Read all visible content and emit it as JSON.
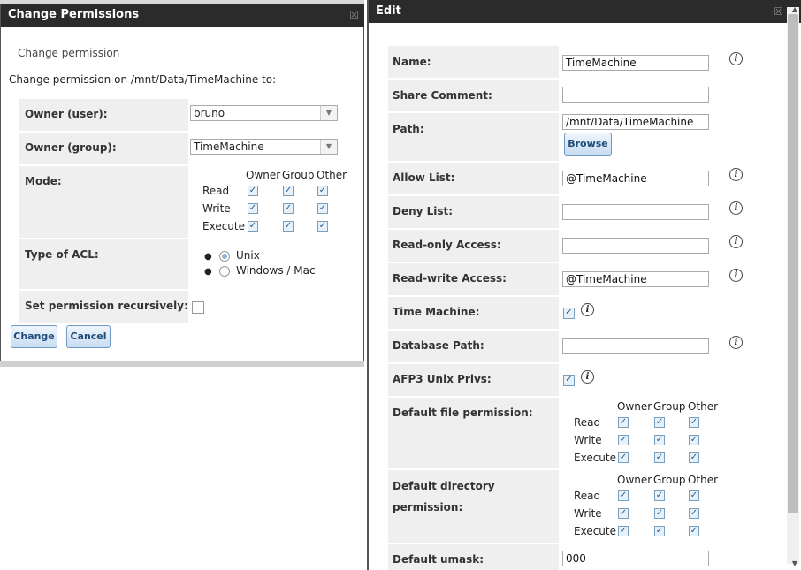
{
  "perm": {
    "title": "Change Permissions",
    "close": "☒",
    "subtitle": "Change permission",
    "description": "Change permission on /mnt/Data/TimeMachine to:",
    "owner_user_label": "Owner (user):",
    "owner_user_value": "bruno",
    "owner_group_label": "Owner (group):",
    "owner_group_value": "TimeMachine",
    "mode_label": "Mode:",
    "col_owner": "Owner",
    "col_group": "Group",
    "col_other": "Other",
    "row_read": "Read",
    "row_write": "Write",
    "row_execute": "Execute",
    "acl_label": "Type of ACL:",
    "acl_unix": "Unix",
    "acl_windows": "Windows / Mac",
    "recursive_label": "Set permission recursively:",
    "change_button": "Change",
    "cancel_button": "Cancel"
  },
  "edit": {
    "title": "Edit",
    "close": "☒",
    "name_label": "Name:",
    "name_value": "TimeMachine",
    "comment_label": "Share Comment:",
    "comment_value": "",
    "path_label": "Path:",
    "path_value": "/mnt/Data/TimeMachine",
    "browse_button": "Browse",
    "allow_label": "Allow List:",
    "allow_value": "@TimeMachine",
    "deny_label": "Deny List:",
    "deny_value": "",
    "ro_label": "Read-only Access:",
    "ro_value": "",
    "rw_label": "Read-write Access:",
    "rw_value": "@TimeMachine",
    "tm_label": "Time Machine:",
    "db_label": "Database Path:",
    "db_value": "",
    "afp3_label": "AFP3 Unix Privs:",
    "file_perm_label": "Default file permission:",
    "dir_perm_label_1": "Default directory",
    "dir_perm_label_2": "permission:",
    "col_owner": "Owner",
    "col_group": "Group",
    "col_other": "Other",
    "row_read": "Read",
    "row_write": "Write",
    "row_execute": "Execute",
    "umask_label": "Default umask:",
    "umask_value": "000",
    "info_glyph": "i"
  },
  "colors": {
    "titlebar": "#2b2b2b",
    "label_cell": "#efefef",
    "button_text": "#1f4b79"
  }
}
